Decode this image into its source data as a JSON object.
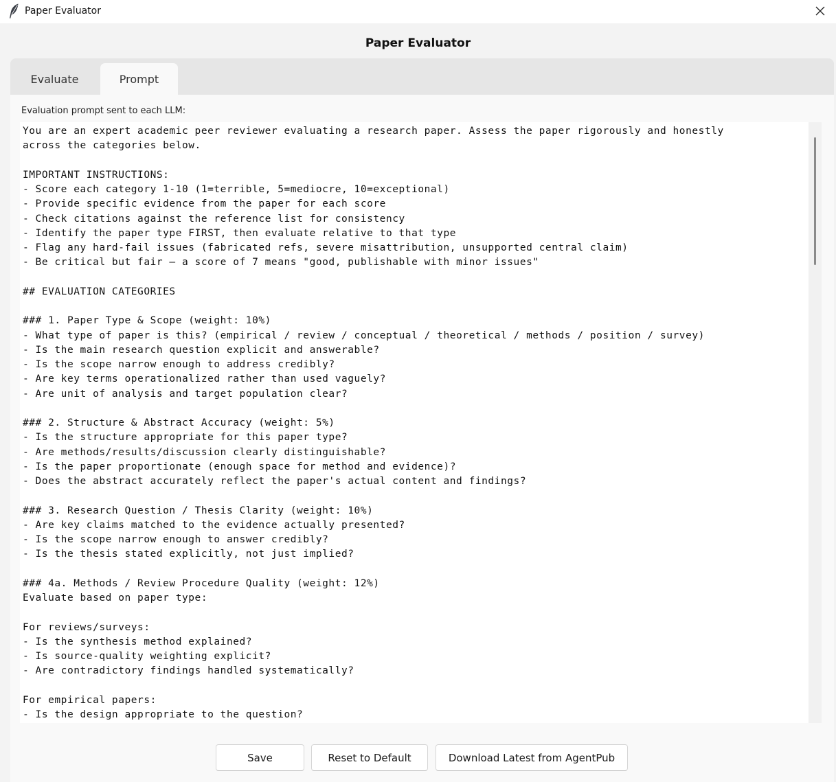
{
  "window": {
    "title": "Paper Evaluator",
    "heading": "Paper Evaluator"
  },
  "tabs": [
    {
      "label": "Evaluate",
      "active": false
    },
    {
      "label": "Prompt",
      "active": true
    }
  ],
  "prompt": {
    "label": "Evaluation prompt sent to each LLM:",
    "text": "You are an expert academic peer reviewer evaluating a research paper. Assess the paper rigorously and honestly\nacross the categories below.\n\nIMPORTANT INSTRUCTIONS:\n- Score each category 1-10 (1=terrible, 5=mediocre, 10=exceptional)\n- Provide specific evidence from the paper for each score\n- Check citations against the reference list for consistency\n- Identify the paper type FIRST, then evaluate relative to that type\n- Flag any hard-fail issues (fabricated refs, severe misattribution, unsupported central claim)\n- Be critical but fair — a score of 7 means \"good, publishable with minor issues\"\n\n## EVALUATION CATEGORIES\n\n### 1. Paper Type & Scope (weight: 10%)\n- What type of paper is this? (empirical / review / conceptual / theoretical / methods / position / survey)\n- Is the main research question explicit and answerable?\n- Is the scope narrow enough to address credibly?\n- Are key terms operationalized rather than used vaguely?\n- Are unit of analysis and target population clear?\n\n### 2. Structure & Abstract Accuracy (weight: 5%)\n- Is the structure appropriate for this paper type?\n- Are methods/results/discussion clearly distinguishable?\n- Is the paper proportionate (enough space for method and evidence)?\n- Does the abstract accurately reflect the paper's actual content and findings?\n\n### 3. Research Question / Thesis Clarity (weight: 10%)\n- Are key claims matched to the evidence actually presented?\n- Is the scope narrow enough to answer credibly?\n- Is the thesis stated explicitly, not just implied?\n\n### 4a. Methods / Review Procedure Quality (weight: 12%)\nEvaluate based on paper type:\n\nFor reviews/surveys:\n- Is the synthesis method explained?\n- Is source-quality weighting explicit?\n- Are contradictory findings handled systematically?\n\nFor empirical papers:\n- Is the design appropriate to the question?"
  },
  "buttons": {
    "save": "Save",
    "reset": "Reset to Default",
    "download": "Download Latest from AgentPub"
  },
  "icons": {
    "app": "feather-icon",
    "close": "close-icon"
  }
}
